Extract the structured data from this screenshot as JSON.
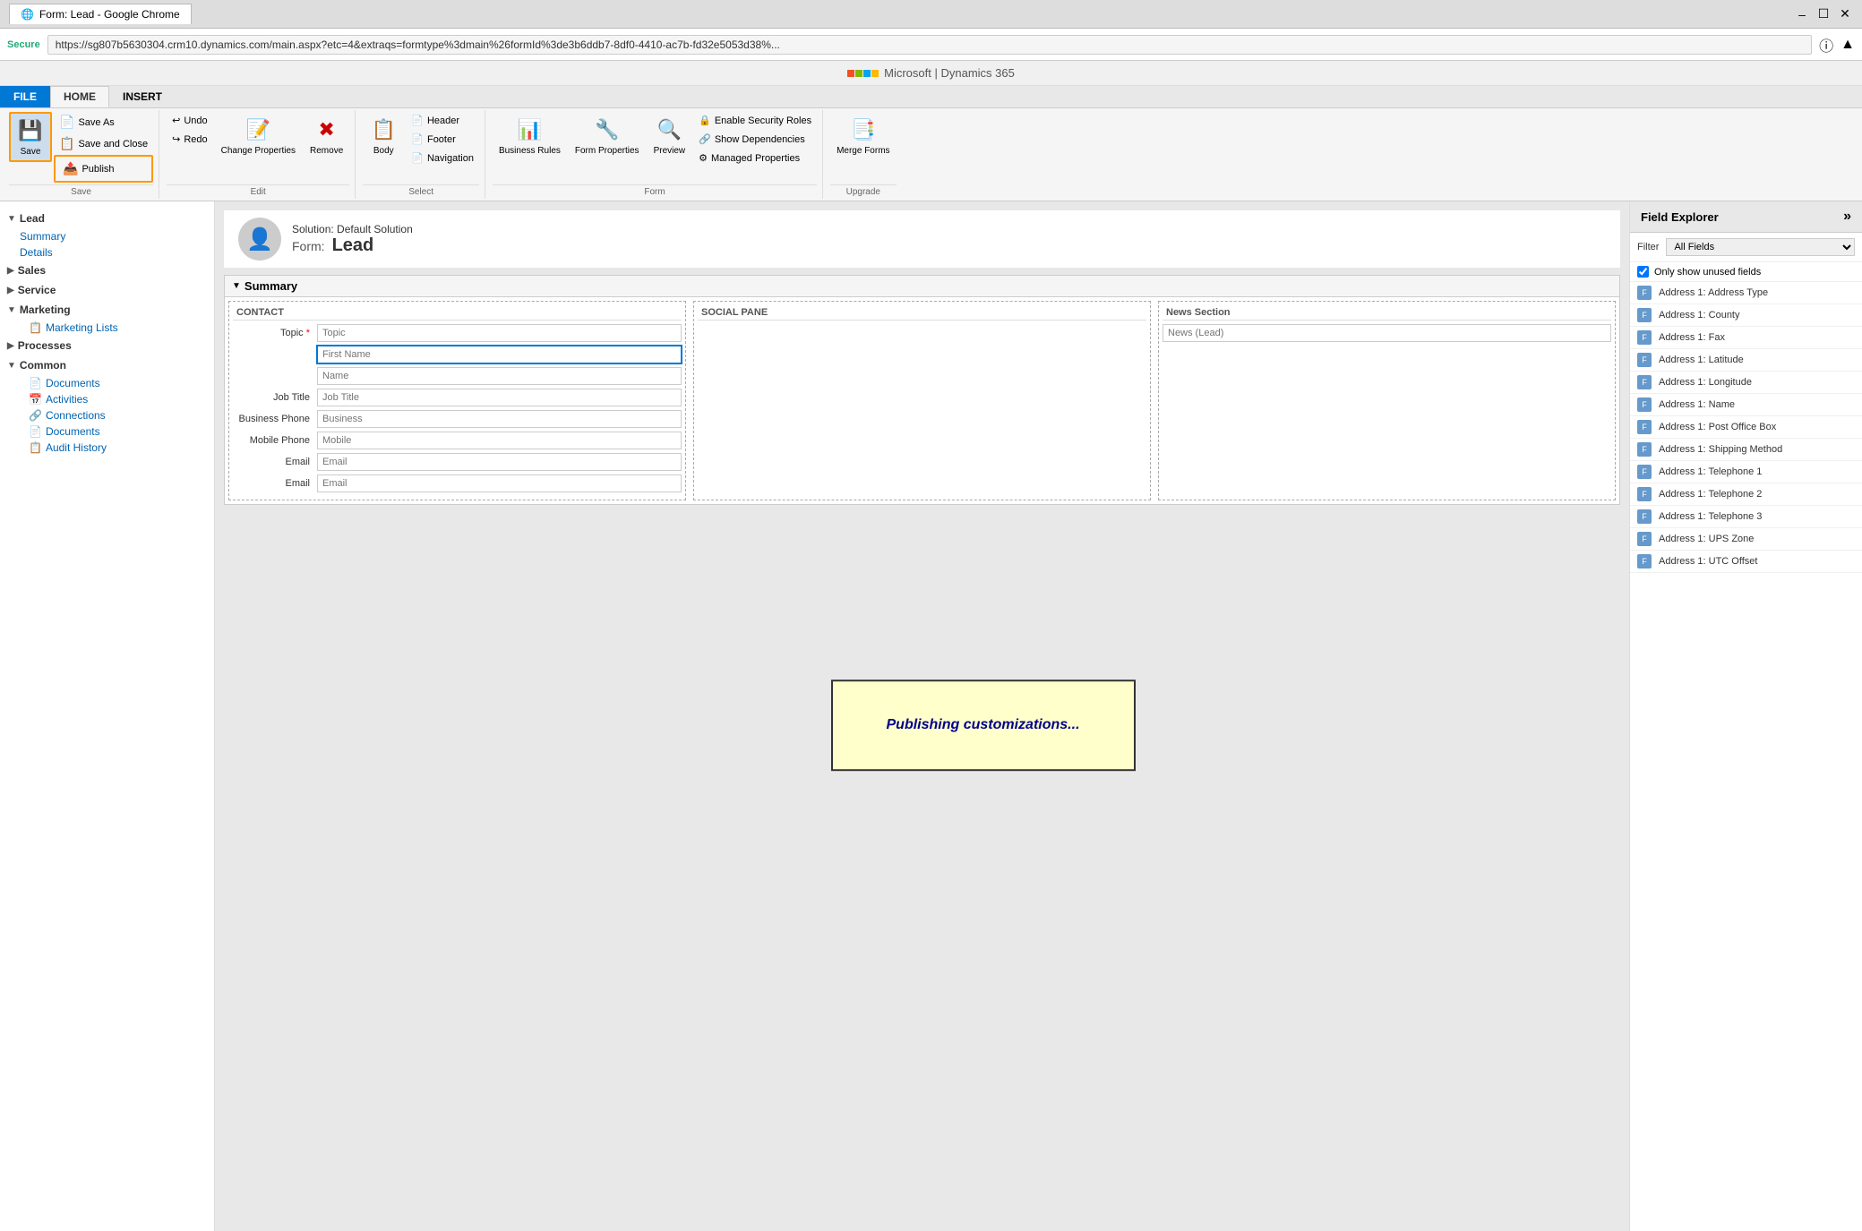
{
  "browser": {
    "tab_title": "Form: Lead - Google Chrome",
    "url": "https://sg807b5630304.crm10.dynamics.com/main.aspx?etc=4&extraqs=formtype%3dmain%26formId%3de3b6ddb7-8df0-4410-ac7b-fd32e5053d38%...",
    "secure_label": "Secure",
    "branding": "Microsoft  |  Dynamics 365"
  },
  "ribbon": {
    "tabs": [
      "FILE",
      "HOME",
      "INSERT"
    ],
    "active_tab": "HOME",
    "groups": {
      "save": {
        "label": "Save",
        "buttons": [
          {
            "id": "save",
            "label": "Save",
            "icon": "💾"
          },
          {
            "id": "save-as",
            "label": "Save As",
            "icon": "📄"
          },
          {
            "id": "save-and-close",
            "label": "Save and Close",
            "icon": "📋"
          },
          {
            "id": "publish",
            "label": "Publish",
            "icon": "📤",
            "highlighted": true
          }
        ]
      },
      "edit": {
        "label": "Edit",
        "undo": "Undo",
        "redo": "Redo",
        "change_properties": "Change Properties",
        "remove": "Remove"
      },
      "select": {
        "label": "Select",
        "header": "Header",
        "footer": "Footer",
        "body": "Body",
        "navigation": "Navigation"
      },
      "form": {
        "label": "Form",
        "business_rules": "Business Rules",
        "form_properties": "Form Properties",
        "preview": "Preview",
        "enable_security_roles": "Enable Security Roles",
        "show_dependencies": "Show Dependencies",
        "managed_properties": "Managed Properties"
      },
      "upgrade": {
        "label": "Upgrade",
        "merge_forms": "Merge Forms"
      }
    }
  },
  "sidebar": {
    "sections": [
      {
        "name": "Lead",
        "items": [
          {
            "label": "Summary",
            "type": "link"
          },
          {
            "label": "Details",
            "type": "link"
          }
        ]
      },
      {
        "name": "Sales",
        "items": []
      },
      {
        "name": "Service",
        "items": []
      },
      {
        "name": "Marketing",
        "items": [
          {
            "label": "Marketing Lists",
            "type": "link",
            "icon": "📋"
          }
        ]
      },
      {
        "name": "Processes",
        "items": []
      },
      {
        "name": "Common",
        "items": [
          {
            "label": "Documents",
            "type": "link",
            "icon": "📄"
          },
          {
            "label": "Activities",
            "type": "link",
            "icon": "📅"
          },
          {
            "label": "Connections",
            "type": "link",
            "icon": "🔗"
          },
          {
            "label": "Documents",
            "type": "link",
            "icon": "📄"
          },
          {
            "label": "Audit History",
            "type": "link",
            "icon": "📋"
          }
        ]
      }
    ]
  },
  "form": {
    "solution": "Solution: Default Solution",
    "form_label": "Form:",
    "form_name": "Lead",
    "section_name": "Summary",
    "columns": [
      {
        "header": "CONTACT",
        "fields": [
          {
            "label": "Topic",
            "required": true,
            "placeholder": "Topic",
            "type": "text"
          },
          {
            "label": "",
            "placeholder": "First Name",
            "type": "text",
            "highlighted": true
          },
          {
            "label": "",
            "placeholder": "Name",
            "type": "text"
          },
          {
            "label": "Job Title",
            "placeholder": "Job Title",
            "type": "text"
          },
          {
            "label": "Business Phone",
            "placeholder": "Business",
            "type": "text"
          },
          {
            "label": "Mobile Phone",
            "placeholder": "Mobile",
            "type": "text"
          },
          {
            "label": "Email",
            "placeholder": "Email",
            "type": "text"
          },
          {
            "label": "Email",
            "placeholder": "Email",
            "type": "text"
          }
        ]
      },
      {
        "header": "SOCIAL PANE",
        "fields": []
      },
      {
        "header": "News Section",
        "fields": [
          {
            "label": "",
            "placeholder": "News (Lead)",
            "type": "text"
          }
        ]
      }
    ]
  },
  "publishing": {
    "message": "Publishing customizations..."
  },
  "field_explorer": {
    "title": "Field Explorer",
    "filter_label": "Filter",
    "filter_value": "All Fields",
    "checkbox_label": "Only show unused fields",
    "fields": [
      "Address 1: Address Type",
      "Address 1: County",
      "Address 1: Fax",
      "Address 1: Latitude",
      "Address 1: Longitude",
      "Address 1: Name",
      "Address 1: Post Office Box",
      "Address 1: Shipping Method",
      "Address 1: Telephone 1",
      "Address 1: Telephone 2",
      "Address 1: Telephone 3",
      "Address 1: UPS Zone",
      "Address 1: UTC Offset"
    ]
  }
}
